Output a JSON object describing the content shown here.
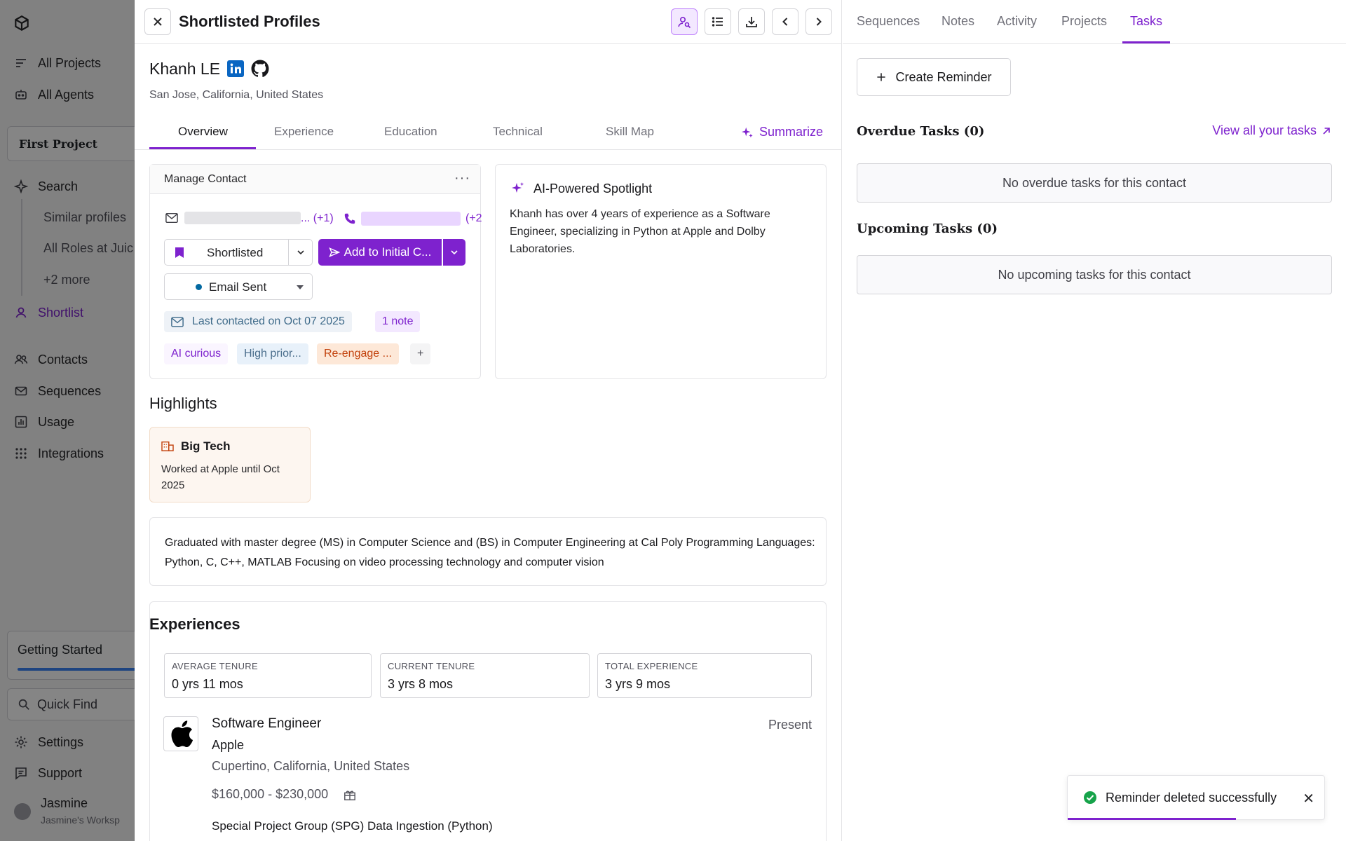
{
  "sidebar": {
    "items": {
      "all_projects": "All Projects",
      "all_agents": "All Agents",
      "search": "Search",
      "shortlist": "Shortlist",
      "contacts": "Contacts",
      "sequences": "Sequences",
      "usage": "Usage",
      "integrations": "Integrations",
      "settings": "Settings",
      "support": "Support"
    },
    "project": "First Project",
    "search_subitems": [
      "Similar profiles",
      "All Roles at Juic",
      "+2 more"
    ],
    "getting_started": "Getting Started",
    "quick_find": "Quick Find",
    "user_name": "Jasmine",
    "workspace": "Jasmine's Worksp"
  },
  "profile_panel": {
    "title": "Shortlisted Profiles",
    "name": "Khanh LE",
    "location": "San Jose, California, United States",
    "tabs": [
      "Overview",
      "Experience",
      "Education",
      "Technical",
      "Skill Map"
    ],
    "active_tab": "Overview",
    "summarize_label": "Summarize"
  },
  "manage_contact": {
    "title": "Manage Contact",
    "email_more": "... (+1)",
    "phone_more": "(+2",
    "status": "Shortlisted",
    "sequence_button": "Add to Initial C...",
    "email_status": "Email Sent",
    "last_contacted": "Last contacted on Oct 07 2025",
    "notes": "1 note",
    "tags": [
      "AI curious",
      "High prior...",
      "Re-engage ..."
    ],
    "add_tag": "+"
  },
  "spotlight": {
    "title": "AI-Powered Spotlight",
    "text": "Khanh has over 4 years of experience as a Software Engineer, specializing in Python at Apple and Dolby Laboratories."
  },
  "highlights": {
    "title": "Highlights",
    "card_title": "Big Tech",
    "card_text": "Worked at Apple until Oct 2025"
  },
  "education_summary": "Graduated with master degree (MS) in Computer Science and (BS) in Computer Engineering at Cal Poly Programming Languages: Python, C, C++, MATLAB Focusing on video processing technology and computer vision",
  "experiences": {
    "title": "Experiences",
    "stats": [
      {
        "label": "AVERAGE TENURE",
        "value": "0 yrs 11 mos"
      },
      {
        "label": "CURRENT TENURE",
        "value": "3 yrs 8 mos"
      },
      {
        "label": "TOTAL EXPERIENCE",
        "value": "3 yrs 9 mos"
      }
    ],
    "job": {
      "role": "Software Engineer",
      "company": "Apple",
      "location": "Cupertino, California, United States",
      "salary": "$160,000 - $230,000",
      "period": "Present",
      "project": "Special Project Group (SPG) Data Ingestion (Python)"
    }
  },
  "right_panel": {
    "tabs": [
      "Sequences",
      "Notes",
      "Activity",
      "Projects",
      "Tasks"
    ],
    "active_tab": "Tasks",
    "create_reminder": "Create Reminder",
    "overdue_title": "Overdue Tasks (0)",
    "view_all": "View all your tasks",
    "overdue_empty": "No overdue tasks for this contact",
    "upcoming_title": "Upcoming Tasks (0)",
    "upcoming_empty": "No upcoming tasks for this contact"
  },
  "toast": {
    "message": "Reminder deleted successfully"
  },
  "colors": {
    "accent": "#7e22ce",
    "success": "#16a34a",
    "linkedin": "#0a66c2"
  }
}
